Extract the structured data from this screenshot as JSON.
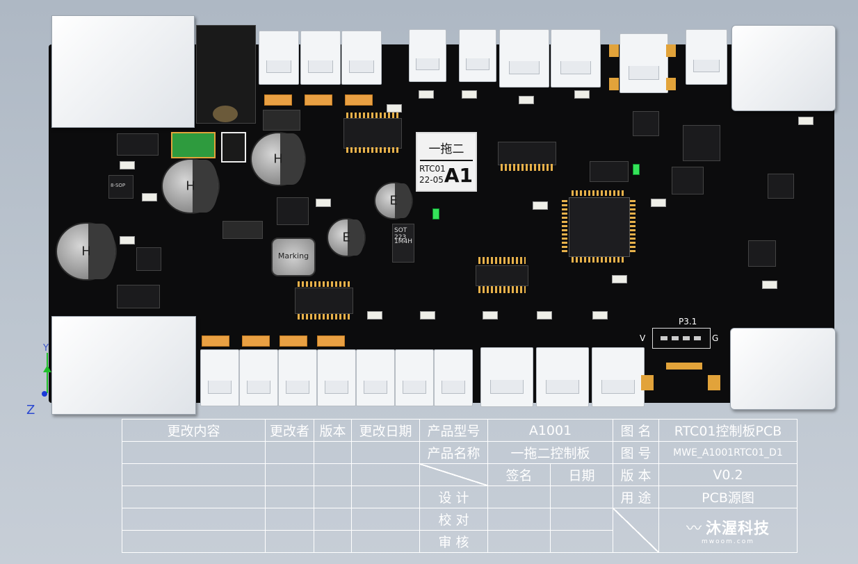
{
  "board": {
    "label_main": "一拖二",
    "label_model": "RTC01",
    "label_date": "22-05",
    "label_rev": "A1",
    "connector_label": "P3.1",
    "connector_left": "V",
    "connector_right": "G",
    "inductor_marking": "Marking",
    "cap_marks": [
      "H",
      "H",
      "H",
      "E",
      "E"
    ],
    "sot_label": "SOT 223",
    "sot_code": "1M4H",
    "soic_label": "8-SOP"
  },
  "axes": {
    "y": "Y",
    "z": "Z"
  },
  "colors": {
    "pcb": "#0c0c0d",
    "pad": "#e2a33a",
    "led": "#35e35a",
    "background": "#b8c1cc"
  },
  "titleblock": {
    "h_change_content": "更改内容",
    "h_changer": "更改者",
    "h_version": "版本",
    "h_change_date": "更改日期",
    "h_model": "产品型号",
    "model": "A1001",
    "h_drawing_name": "图 名",
    "drawing_name": "RTC01控制板PCB",
    "h_product_name": "产品名称",
    "product_name": "一拖二控制板",
    "h_drawing_no": "图 号",
    "drawing_no": "MWE_A1001RTC01_D1",
    "h_sign": "签名",
    "h_date": "日期",
    "h_ver": "版 本",
    "ver": "V0.2",
    "h_design": "设 计",
    "h_usage": "用 途",
    "usage": "PCB源图",
    "h_check": "校 对",
    "h_review": "审 核",
    "company": "沐渥科技",
    "company_sub": "mwoom.com"
  }
}
